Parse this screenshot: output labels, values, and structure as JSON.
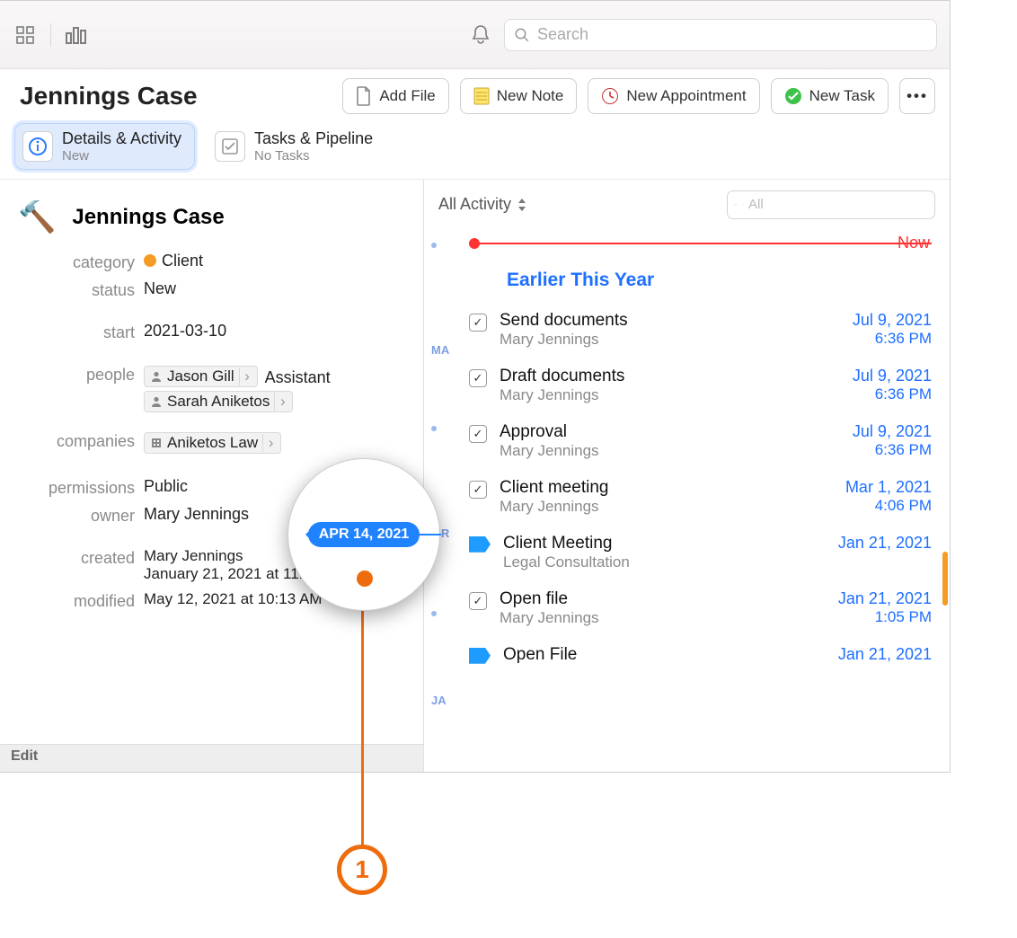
{
  "toolbar": {
    "search_placeholder": "Search"
  },
  "header": {
    "page_title": "Jennings Case",
    "add_file": "Add File",
    "new_note": "New Note",
    "new_appointment": "New Appointment",
    "new_task": "New Task"
  },
  "tabs": {
    "details": {
      "label": "Details & Activity",
      "sub": "New"
    },
    "tasks": {
      "label": "Tasks & Pipeline",
      "sub": "No Tasks"
    }
  },
  "details": {
    "title": "Jennings Case",
    "category_label": "category",
    "category_value": "Client",
    "status_label": "status",
    "status_value": "New",
    "start_label": "start",
    "start_value": "2021-03-10",
    "people_label": "people",
    "people": [
      {
        "name": "Jason Gill",
        "role": "Assistant"
      },
      {
        "name": "Sarah Aniketos",
        "role": ""
      }
    ],
    "companies_label": "companies",
    "companies": [
      {
        "name": "Aniketos Law"
      }
    ],
    "permissions_label": "permissions",
    "permissions_value": "Public",
    "owner_label": "owner",
    "owner_value": "Mary Jennings",
    "created_label": "created",
    "created_by": "Mary Jennings",
    "created_at": "January 21, 2021 at 11:55 AM",
    "modified_label": "modified",
    "modified_value": "May 12, 2021 at 10:13 AM",
    "edit": "Edit"
  },
  "activity": {
    "filter_label": "All Activity",
    "search_placeholder": "All",
    "now_label": "Now",
    "section": "Earlier This Year",
    "months": {
      "ma": "MA",
      "mr": "MR",
      "ja": "JA"
    },
    "items": [
      {
        "kind": "task",
        "title": "Send documents",
        "sub": "Mary Jennings",
        "date": "Jul 9, 2021",
        "time": "6:36 PM"
      },
      {
        "kind": "task",
        "title": "Draft documents",
        "sub": "Mary Jennings",
        "date": "Jul 9, 2021",
        "time": "6:36 PM"
      },
      {
        "kind": "task",
        "title": "Approval",
        "sub": "Mary Jennings",
        "date": "Jul 9, 2021",
        "time": "6:36 PM"
      },
      {
        "kind": "task",
        "title": "Client meeting",
        "sub": "Mary Jennings",
        "date": "Mar 1, 2021",
        "time": "4:06 PM"
      },
      {
        "kind": "event",
        "title": "Client Meeting",
        "sub": "Legal Consultation",
        "date": "Jan 21, 2021",
        "time": ""
      },
      {
        "kind": "task",
        "title": "Open file",
        "sub": "Mary Jennings",
        "date": "Jan 21, 2021",
        "time": "1:05 PM"
      },
      {
        "kind": "event",
        "title": "Open File",
        "sub": "",
        "date": "Jan 21, 2021",
        "time": ""
      }
    ]
  },
  "callout": {
    "date_label": "APR 14, 2021",
    "number": "1"
  }
}
